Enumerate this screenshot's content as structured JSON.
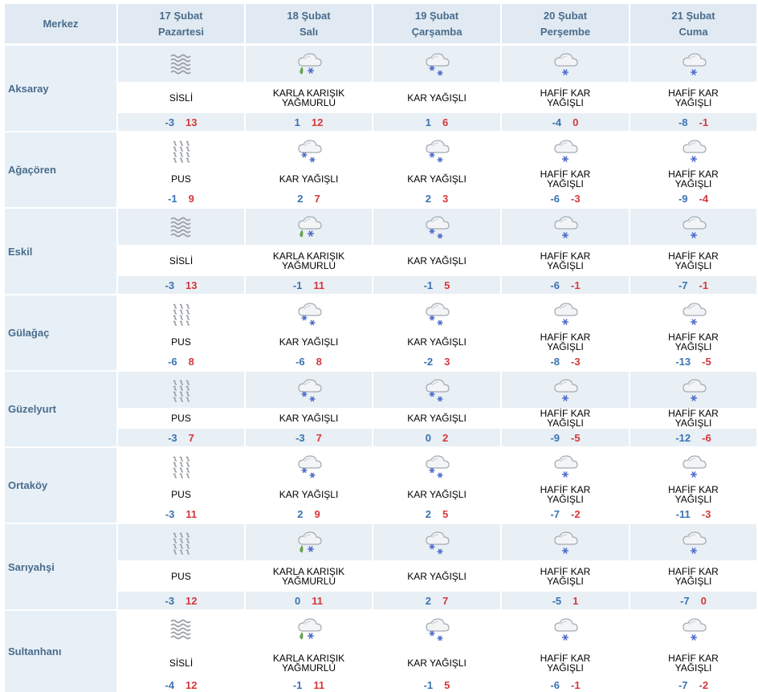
{
  "header": {
    "first": "Merkez",
    "days": [
      {
        "date": "17 Şubat",
        "weekday": "Pazartesi"
      },
      {
        "date": "18 Şubat",
        "weekday": "Salı"
      },
      {
        "date": "19 Şubat",
        "weekday": "Çarşamba"
      },
      {
        "date": "20 Şubat",
        "weekday": "Perşembe"
      },
      {
        "date": "21 Şubat",
        "weekday": "Cuma"
      }
    ]
  },
  "cities": [
    {
      "name": "Aksaray",
      "shaded": true,
      "days": [
        {
          "icon": "fog-icon",
          "desc": "SİSLİ",
          "min": "-3",
          "max": "13"
        },
        {
          "icon": "sleet-icon",
          "desc": "KARLA KARIŞIK YAĞMURLU",
          "min": "1",
          "max": "12"
        },
        {
          "icon": "snow-icon",
          "desc": "KAR YAĞIŞLI",
          "min": "1",
          "max": "6"
        },
        {
          "icon": "light-snow-icon",
          "desc": "HAFİF KAR YAĞIŞLI",
          "min": "-4",
          "max": "0"
        },
        {
          "icon": "light-snow-icon",
          "desc": "HAFİF KAR YAĞIŞLI",
          "min": "-8",
          "max": "-1"
        }
      ]
    },
    {
      "name": "Ağaçören",
      "shaded": false,
      "days": [
        {
          "icon": "mist-icon",
          "desc": "PUS",
          "min": "-1",
          "max": "9"
        },
        {
          "icon": "snow-icon",
          "desc": "KAR YAĞIŞLI",
          "min": "2",
          "max": "7"
        },
        {
          "icon": "snow-icon",
          "desc": "KAR YAĞIŞLI",
          "min": "2",
          "max": "3"
        },
        {
          "icon": "light-snow-icon",
          "desc": "HAFİF KAR YAĞIŞLI",
          "min": "-6",
          "max": "-3"
        },
        {
          "icon": "light-snow-icon",
          "desc": "HAFİF KAR YAĞIŞLI",
          "min": "-9",
          "max": "-4"
        }
      ]
    },
    {
      "name": "Eskil",
      "shaded": true,
      "days": [
        {
          "icon": "fog-icon",
          "desc": "SİSLİ",
          "min": "-3",
          "max": "13"
        },
        {
          "icon": "sleet-icon",
          "desc": "KARLA KARIŞIK YAĞMURLU",
          "min": "-1",
          "max": "11"
        },
        {
          "icon": "snow-icon",
          "desc": "KAR YAĞIŞLI",
          "min": "-1",
          "max": "5"
        },
        {
          "icon": "light-snow-icon",
          "desc": "HAFİF KAR YAĞIŞLI",
          "min": "-6",
          "max": "-1"
        },
        {
          "icon": "light-snow-icon",
          "desc": "HAFİF KAR YAĞIŞLI",
          "min": "-7",
          "max": "-1"
        }
      ]
    },
    {
      "name": "Gülağaç",
      "shaded": false,
      "days": [
        {
          "icon": "mist-icon",
          "desc": "PUS",
          "min": "-6",
          "max": "8"
        },
        {
          "icon": "snow-icon",
          "desc": "KAR YAĞIŞLI",
          "min": "-6",
          "max": "8"
        },
        {
          "icon": "snow-icon",
          "desc": "KAR YAĞIŞLI",
          "min": "-2",
          "max": "3"
        },
        {
          "icon": "light-snow-icon",
          "desc": "HAFİF KAR YAĞIŞLI",
          "min": "-8",
          "max": "-3"
        },
        {
          "icon": "light-snow-icon",
          "desc": "HAFİF KAR YAĞIŞLI",
          "min": "-13",
          "max": "-5"
        }
      ]
    },
    {
      "name": "Güzelyurt",
      "shaded": true,
      "days": [
        {
          "icon": "mist-icon",
          "desc": "PUS",
          "min": "-3",
          "max": "7"
        },
        {
          "icon": "snow-icon",
          "desc": "KAR YAĞIŞLI",
          "min": "-3",
          "max": "7"
        },
        {
          "icon": "snow-icon",
          "desc": "KAR YAĞIŞLI",
          "min": "0",
          "max": "2"
        },
        {
          "icon": "light-snow-icon",
          "desc": "HAFİF KAR YAĞIŞLI",
          "min": "-9",
          "max": "-5"
        },
        {
          "icon": "light-snow-icon",
          "desc": "HAFİF KAR YAĞIŞLI",
          "min": "-12",
          "max": "-6"
        }
      ]
    },
    {
      "name": "Ortaköy",
      "shaded": false,
      "days": [
        {
          "icon": "mist-icon",
          "desc": "PUS",
          "min": "-3",
          "max": "11"
        },
        {
          "icon": "snow-icon",
          "desc": "KAR YAĞIŞLI",
          "min": "2",
          "max": "9"
        },
        {
          "icon": "snow-icon",
          "desc": "KAR YAĞIŞLI",
          "min": "2",
          "max": "5"
        },
        {
          "icon": "light-snow-icon",
          "desc": "HAFİF KAR YAĞIŞLI",
          "min": "-7",
          "max": "-2"
        },
        {
          "icon": "light-snow-icon",
          "desc": "HAFİF KAR YAĞIŞLI",
          "min": "-11",
          "max": "-3"
        }
      ]
    },
    {
      "name": "Sarıyahşi",
      "shaded": true,
      "days": [
        {
          "icon": "mist-icon",
          "desc": "PUS",
          "min": "-3",
          "max": "12"
        },
        {
          "icon": "sleet-icon",
          "desc": "KARLA KARIŞIK YAĞMURLU",
          "min": "0",
          "max": "11"
        },
        {
          "icon": "snow-icon",
          "desc": "KAR YAĞIŞLI",
          "min": "2",
          "max": "7"
        },
        {
          "icon": "light-snow-icon",
          "desc": "HAFİF KAR YAĞIŞLI",
          "min": "-5",
          "max": "1"
        },
        {
          "icon": "light-snow-icon",
          "desc": "HAFİF KAR YAĞIŞLI",
          "min": "-7",
          "max": "0"
        }
      ]
    },
    {
      "name": "Sultanhanı",
      "shaded": false,
      "days": [
        {
          "icon": "fog-icon",
          "desc": "SİSLİ",
          "min": "-4",
          "max": "12"
        },
        {
          "icon": "sleet-icon",
          "desc": "KARLA KARIŞIK YAĞMURLU",
          "min": "-1",
          "max": "11"
        },
        {
          "icon": "snow-icon",
          "desc": "KAR YAĞIŞLI",
          "min": "-1",
          "max": "5"
        },
        {
          "icon": "light-snow-icon",
          "desc": "HAFİF KAR YAĞIŞLI",
          "min": "-6",
          "max": "-1"
        },
        {
          "icon": "light-snow-icon",
          "desc": "HAFİF KAR YAĞIŞLI",
          "min": "-7",
          "max": "-2"
        }
      ]
    }
  ],
  "colors": {
    "header_bg": "#e1eaf2",
    "header_text": "#4a6c8c",
    "min_temp": "#3a73b0",
    "max_temp": "#d3383c",
    "snow": "#4a68c8",
    "rain": "#6ab04c"
  }
}
